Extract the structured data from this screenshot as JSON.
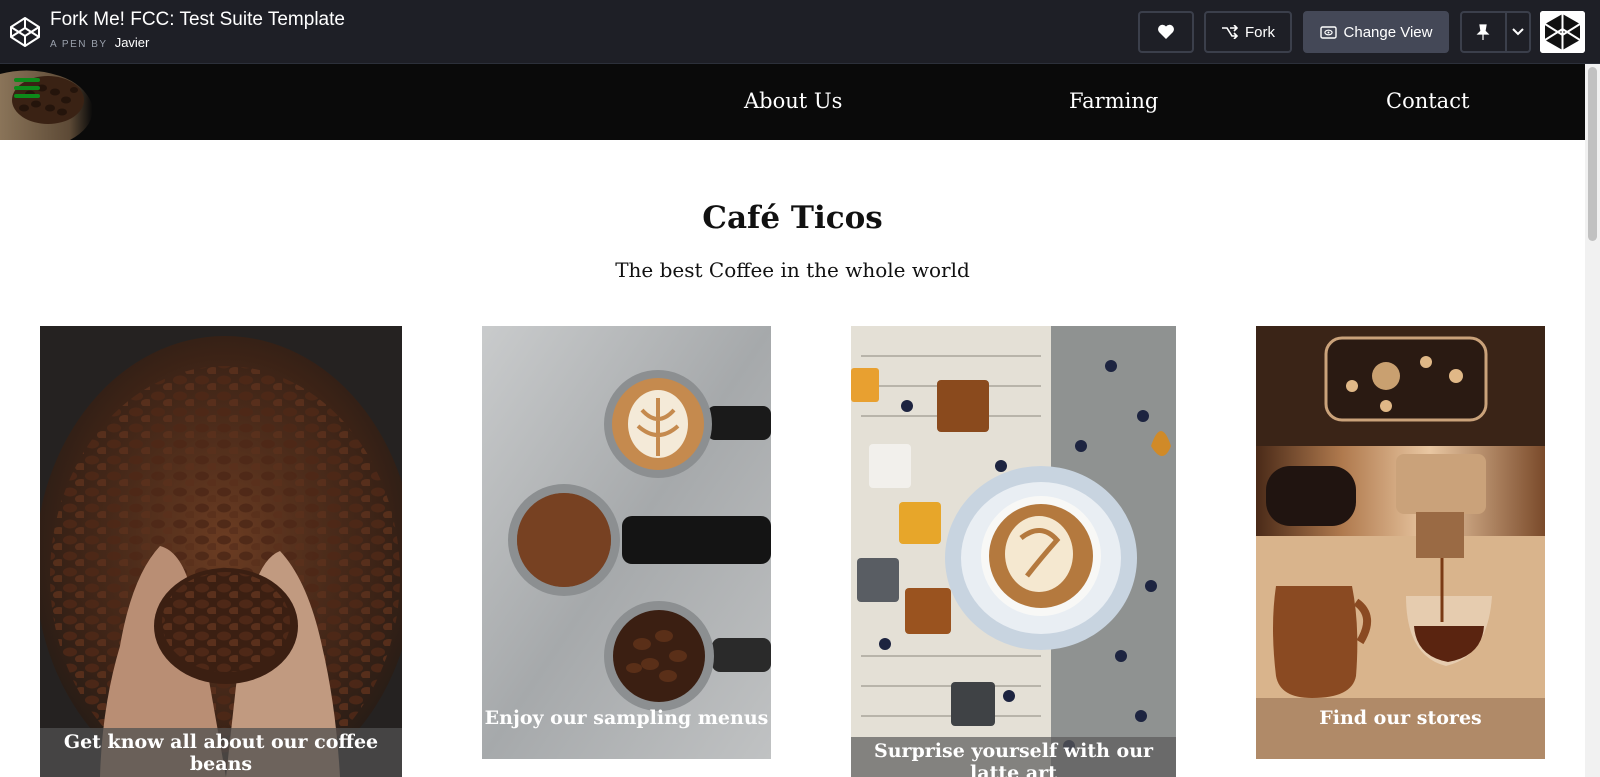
{
  "header": {
    "title": "Fork Me! FCC: Test Suite Template",
    "byline_prefix": "A PEN BY",
    "author": "Javier",
    "fork_label": "Fork",
    "change_view_label": "Change View"
  },
  "site": {
    "nav": [
      "About Us",
      "Farming",
      "Contact"
    ],
    "title": "Café Ticos",
    "subtitle": "The best Coffee in the whole world",
    "cards": [
      "Get know all about our coffee beans",
      "Enjoy our sampling menus",
      "Surprise yourself with our latte art",
      "Find our stores"
    ]
  },
  "icons": [
    "codepen-logo-icon",
    "heart-icon",
    "fork-icon",
    "eye-icon",
    "pin-icon",
    "chevron-down-icon",
    "codepen-avatar-icon"
  ],
  "colors": {
    "header_bg": "#1e1f26",
    "nav_bg": "#0a0a0a",
    "page_bg": "#ffffff"
  }
}
